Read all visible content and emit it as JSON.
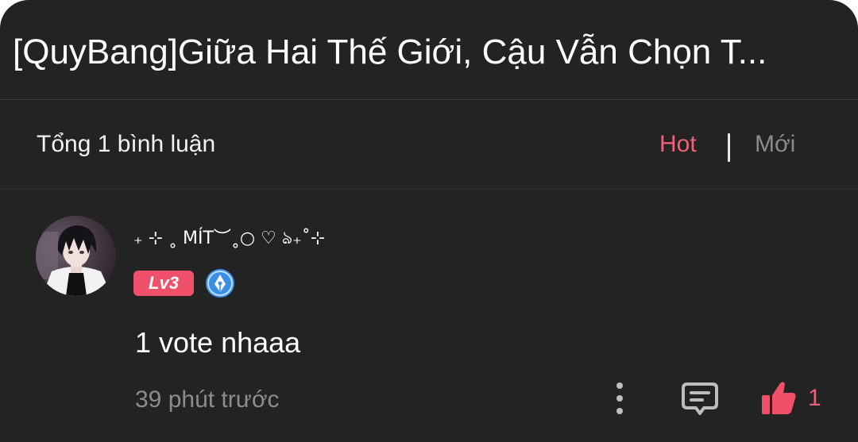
{
  "header": {
    "title": "[QuyBang]Giữa Hai Thế Giới, Cậu Vẫn Chọn T..."
  },
  "summary": {
    "total_label": "Tổng 1 bình luận",
    "sort_hot": "Hot",
    "sort_new": "Mới",
    "active_sort": "Hot"
  },
  "comment": {
    "username": "₊ ⊹ ˳ MÍT︶˳○ ♡ ঌ₊˚⊹",
    "level": "Lv3",
    "content": "1 vote nhaaa",
    "timestamp": "39 phút trước",
    "like_count": "1"
  },
  "colors": {
    "background": "#232323",
    "accent": "#f0607a",
    "badge": "#f0506a",
    "muted_text": "#8c8c8c",
    "writer_badge": "#3a8ee8"
  },
  "icons": {
    "avatar": "avatar-image",
    "writer_badge": "pen-nib-badge-icon",
    "more": "more-vertical-icon",
    "reply": "comment-icon",
    "like": "thumbs-up-icon"
  }
}
